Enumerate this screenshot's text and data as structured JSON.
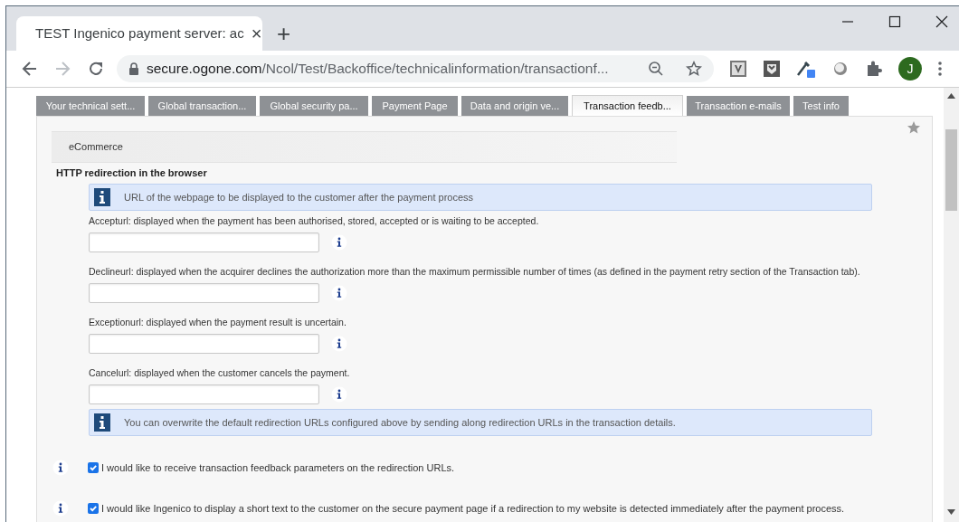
{
  "browser": {
    "tab": {
      "title": "TEST Ingenico payment server: ac",
      "close": "×"
    },
    "new_tab": "+",
    "address": {
      "host": "secure.ogone.com",
      "path": "/Ncol/Test/Backoffice/technicalinformation/transactionf..."
    },
    "avatar": "J"
  },
  "page_tabs": [
    {
      "label": "Your technical sett...",
      "selected": false
    },
    {
      "label": "Global transaction...",
      "selected": false
    },
    {
      "label": "Global security pa...",
      "selected": false
    },
    {
      "label": "Payment Page",
      "selected": false
    },
    {
      "label": "Data and origin ve...",
      "selected": false
    },
    {
      "label": "Transaction feedb...",
      "selected": true
    },
    {
      "label": "Transaction e-mails",
      "selected": false
    },
    {
      "label": "Test info",
      "selected": false
    }
  ],
  "section": "eCommerce",
  "heading": "HTTP redirection in the browser",
  "note": "URL of the webpage to be displayed to the customer after the payment process",
  "url_fields": [
    {
      "label": "Accepturl: displayed when the payment has been authorised, stored, accepted or is waiting to be accepted."
    },
    {
      "label": "Declineurl: displayed when the acquirer declines the authorization more than the maximum permissible number of times (as defined in the payment retry section of the Transaction tab)."
    },
    {
      "label": "Exceptionurl: displayed when the payment result is uncertain."
    },
    {
      "label": "Cancelurl: displayed when the customer cancels the payment."
    }
  ],
  "note_2": "You can overwrite the default redirection URLs configured above by sending along redirection URLs in the transaction details.",
  "options": [
    {
      "label": "I would like to receive transaction feedback parameters on the redirection URLs.",
      "checked": true
    },
    {
      "label": "I would like Ingenico to display a short text to the customer on the secure payment page if a redirection to my website is detected immediately after the payment process.",
      "checked": true
    }
  ]
}
